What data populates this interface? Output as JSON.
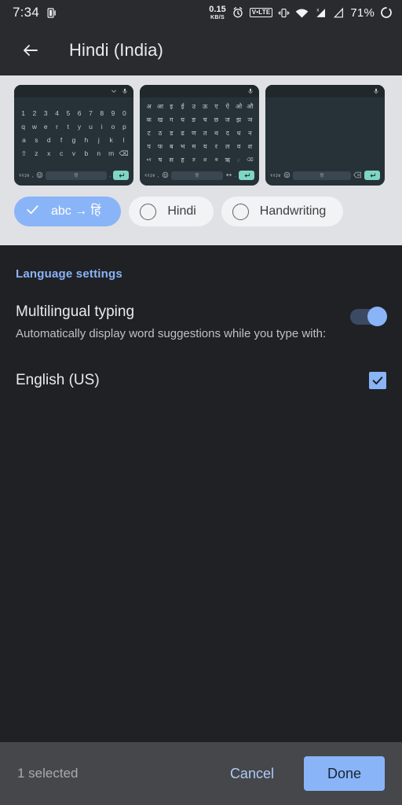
{
  "statusbar": {
    "time": "7:34",
    "screenshot_icon": "screen-icon",
    "net_speed_value": "0.15",
    "net_speed_unit": "KB/S",
    "alarm_icon": "alarm-clock-icon",
    "volte_label": "V•LTE",
    "vibrate_icon": "vibrate-icon",
    "wifi_icon": "wifi-icon",
    "signal1_icon": "signal-no-sim-icon",
    "signal2_icon": "signal-icon",
    "battery_percent": "71%",
    "battery_icon": "battery-circle-icon"
  },
  "appbar": {
    "back_icon": "back-arrow-icon",
    "title": "Hindi (India)"
  },
  "preview": {
    "cards": [
      {
        "name": "qwerty-keyboard-preview",
        "top_icons": [
          "chevron-down-icon",
          "microphone-icon"
        ],
        "rows": [
          [
            "1",
            "2",
            "3",
            "4",
            "5",
            "6",
            "7",
            "8",
            "9",
            "0"
          ],
          [
            "q",
            "w",
            "e",
            "r",
            "t",
            "y",
            "u",
            "i",
            "o",
            "p"
          ],
          [
            "a",
            "s",
            "d",
            "f",
            "g",
            "h",
            "j",
            "k",
            "l"
          ],
          [
            "⇧",
            "z",
            "x",
            "c",
            "v",
            "b",
            "n",
            "m",
            "⌫"
          ]
        ],
        "bottom": {
          "num_key": "१२३४",
          "comma": ",",
          "emoji_icon": "emoji-icon",
          "space_label": "हिं",
          "period": ".",
          "enter_icon": "enter-key-icon"
        }
      },
      {
        "name": "devanagari-keyboard-preview",
        "top_icons": [
          "microphone-icon"
        ],
        "rows": [
          [
            "अ",
            "आ",
            "इ",
            "ई",
            "उ",
            "ऊ",
            "ए",
            "ऐ",
            "ओ",
            "औ"
          ],
          [
            "क",
            "ख",
            "ग",
            "घ",
            "ङ",
            "च",
            "छ",
            "ज",
            "झ",
            "ञ"
          ],
          [
            "ट",
            "ठ",
            "ड",
            "ढ",
            "ण",
            "त",
            "थ",
            "द",
            "ध",
            "न"
          ],
          [
            "प",
            "फ",
            "ब",
            "भ",
            "म",
            "य",
            "र",
            "ल",
            "व",
            "श"
          ],
          [
            "०१",
            "ष",
            "स",
            "ह",
            "ज्ञ",
            "क्ष",
            "श्र",
            "ऋ",
            "़",
            "⌫"
          ]
        ],
        "bottom": {
          "num_key": "१२३४",
          "comma": ",",
          "emoji_icon": "emoji-icon",
          "space_label": "हिं",
          "period": ".",
          "globe_icon": "language-switch-icon",
          "enter_icon": "enter-key-icon"
        }
      },
      {
        "name": "handwriting-keyboard-preview",
        "top_icons": [
          "microphone-icon"
        ],
        "rows": [],
        "bottom": {
          "num_key": "१२३४",
          "emoji_icon": "emoji-icon",
          "space_label": "हिं",
          "backspace_icon": "backspace-icon",
          "enter_icon": "enter-key-icon"
        }
      }
    ],
    "chips": [
      {
        "label": "abc → हिं",
        "selected": true,
        "icon": "check-icon",
        "name": "chip-transliteration"
      },
      {
        "label": "Hindi",
        "selected": false,
        "icon": "radio-unchecked-icon",
        "name": "chip-hindi"
      },
      {
        "label": "Handwriting",
        "selected": false,
        "icon": "radio-unchecked-icon",
        "name": "chip-handwriting"
      }
    ]
  },
  "settings": {
    "section_title": "Language settings",
    "multilingual": {
      "title": "Multilingual typing",
      "subtitle": "Automatically display word suggestions while you type with:",
      "toggle_on": true
    },
    "languages": [
      {
        "name": "English (US)",
        "checked": true
      }
    ]
  },
  "bottombar": {
    "selected_count": "1 selected",
    "cancel_label": "Cancel",
    "done_label": "Done"
  },
  "colors": {
    "accent_blue": "#8ab4f8",
    "link_blue": "#aecbfa",
    "background": "#202124",
    "appbar": "#2a2b2e",
    "preview_bg": "#dfe1e5",
    "bottombar": "#46474a",
    "keyboard_bg": "#263238",
    "enter_key": "#7fd6c4"
  }
}
